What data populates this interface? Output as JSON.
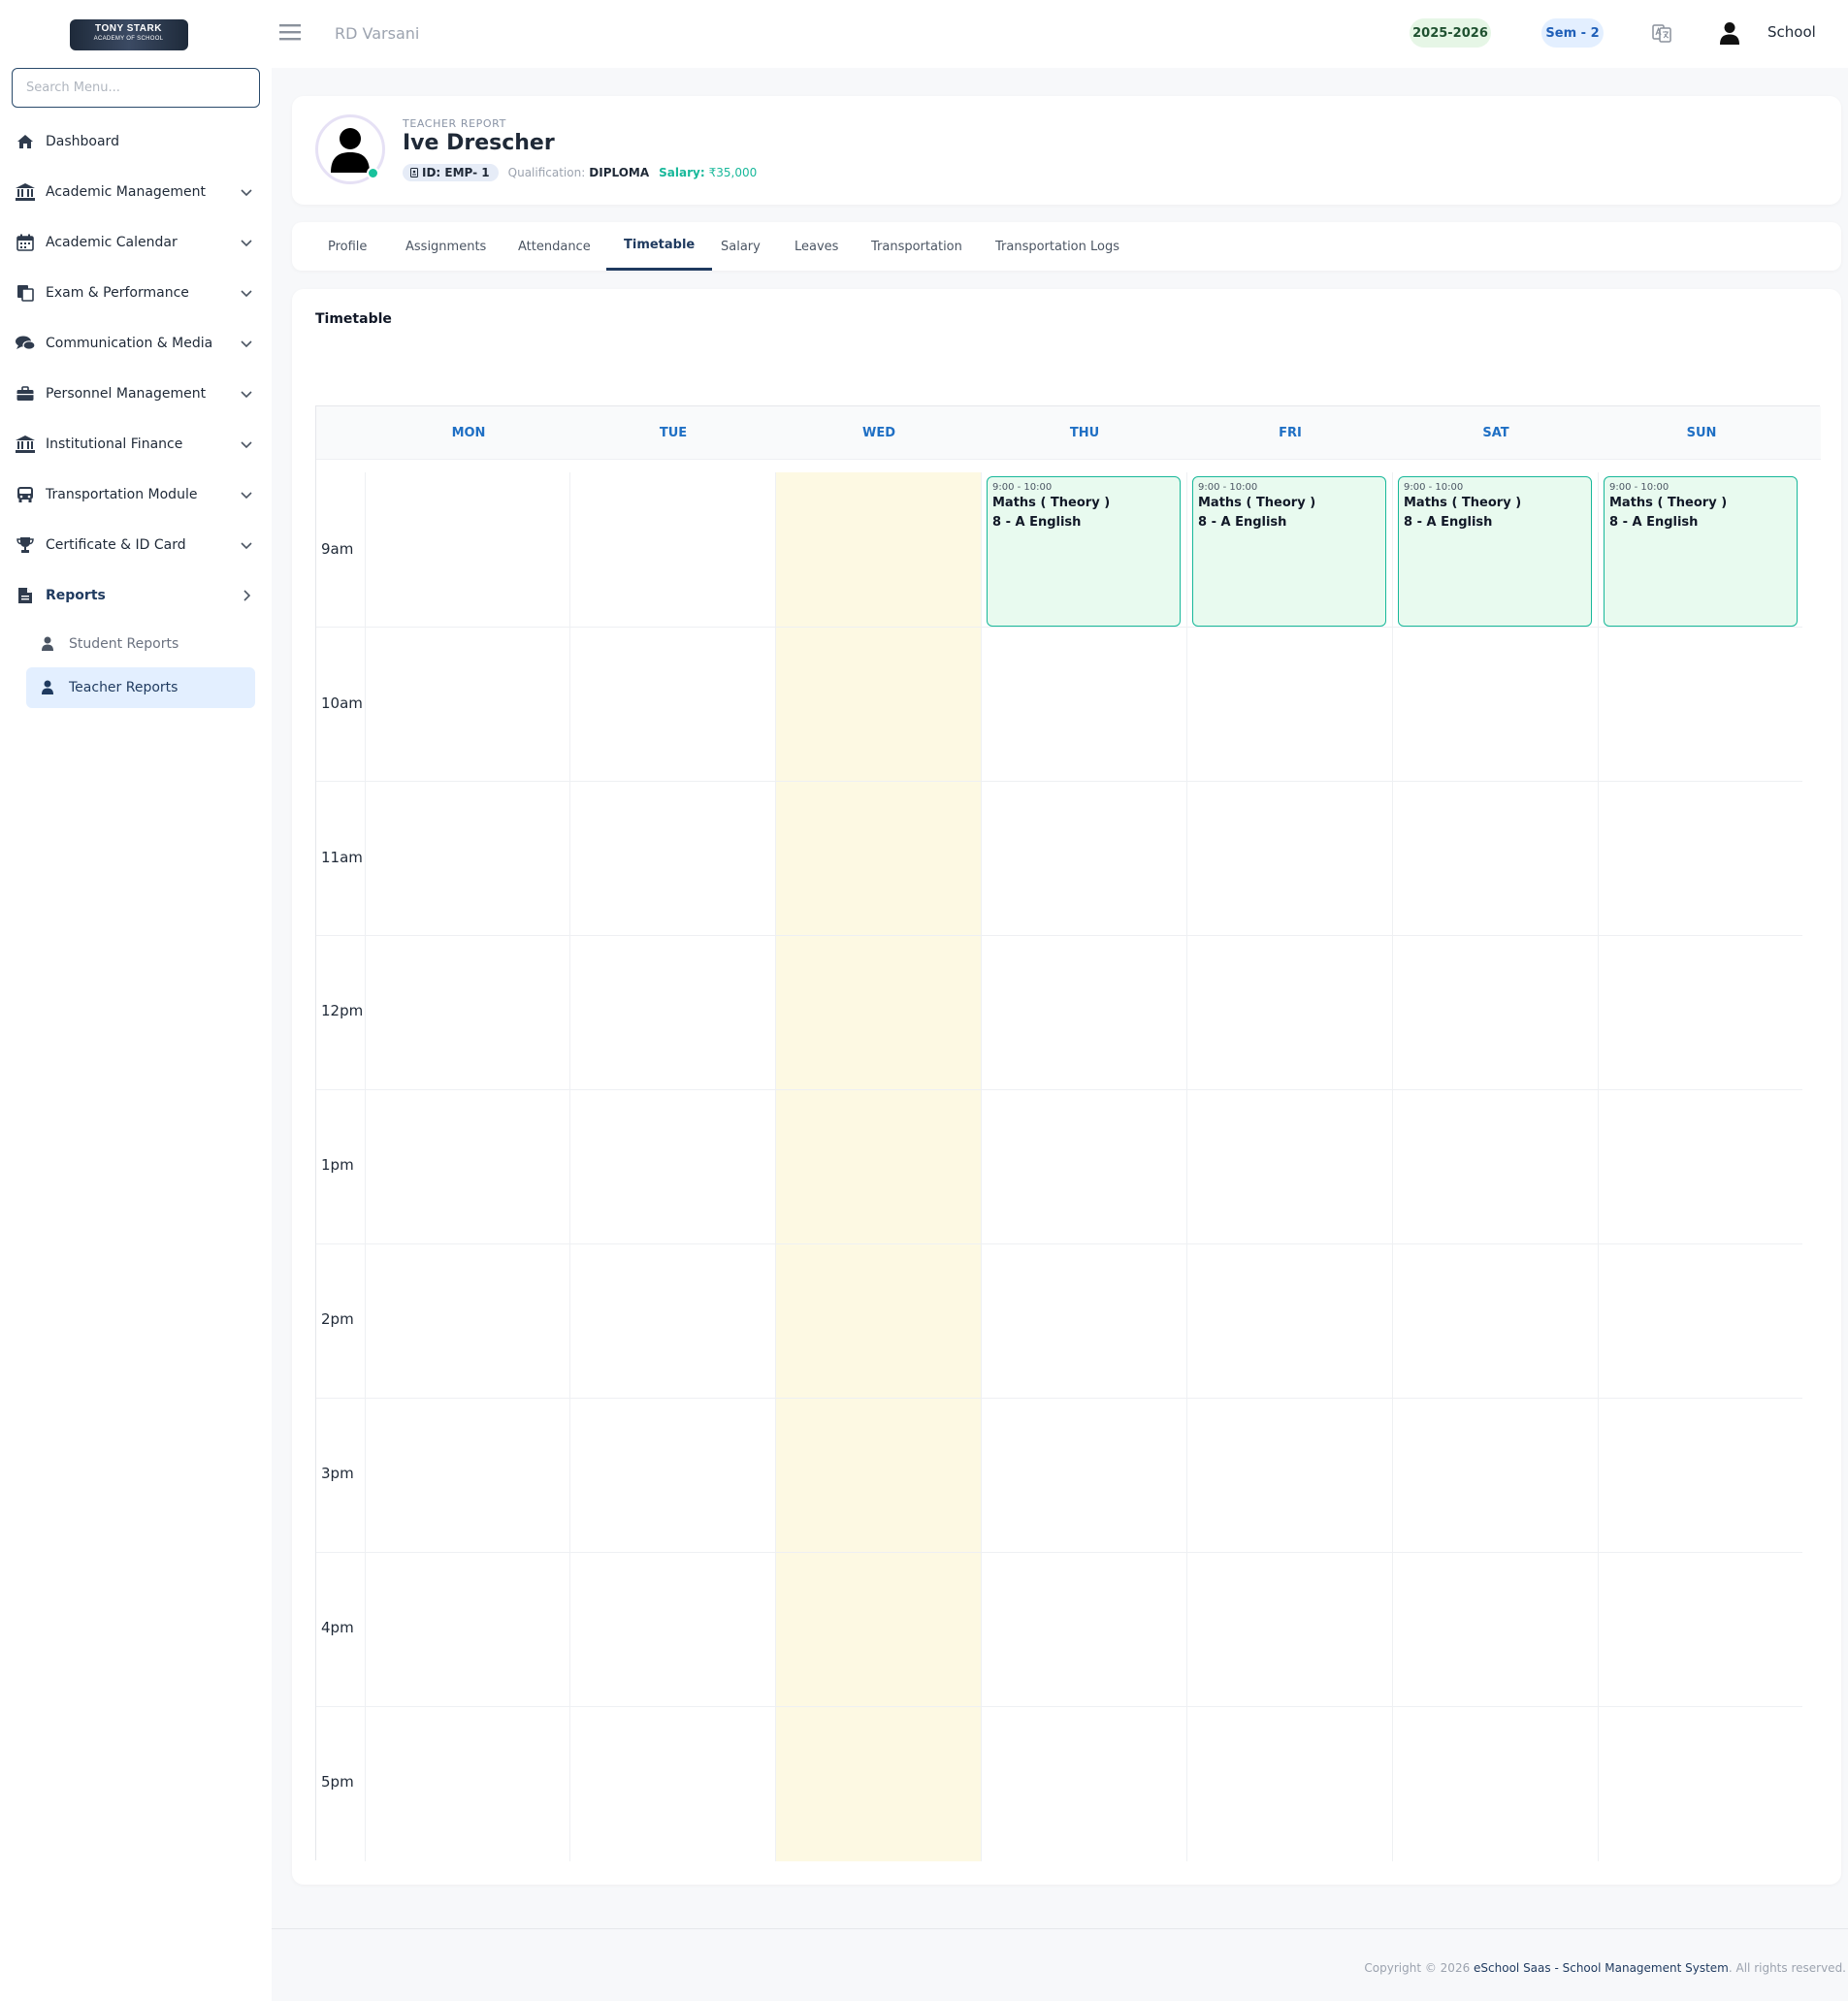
{
  "brand": {
    "logo_line1": "TONY STARK",
    "logo_line2": "ACADEMY OF SCHOOL"
  },
  "sidebar": {
    "search_placeholder": "Search Menu...",
    "items": [
      {
        "label": "Dashboard",
        "icon": "home-icon"
      },
      {
        "label": "Academic Management",
        "icon": "institution-icon"
      },
      {
        "label": "Academic Calendar",
        "icon": "calendar-icon"
      },
      {
        "label": "Exam & Performance",
        "icon": "copy-icon"
      },
      {
        "label": "Communication & Media",
        "icon": "comments-icon"
      },
      {
        "label": "Personnel Management",
        "icon": "briefcase-icon"
      },
      {
        "label": "Institutional Finance",
        "icon": "institution-icon"
      },
      {
        "label": "Transportation Module",
        "icon": "bus-icon"
      },
      {
        "label": "Certificate & ID Card",
        "icon": "trophy-icon"
      },
      {
        "label": "Reports",
        "icon": "file-icon"
      }
    ],
    "sub_items": [
      {
        "label": "Student Reports",
        "icon": "user-icon"
      },
      {
        "label": "Teacher Reports",
        "icon": "user-icon",
        "active": true
      }
    ]
  },
  "topbar": {
    "school_name": "RD Varsani",
    "session": "2025-2026",
    "semester": "Sem - 2",
    "user_label": "School"
  },
  "profile": {
    "kicker": "TEACHER REPORT",
    "name": "Ive Drescher",
    "id": "ID: EMP- 1",
    "qualification_label": "Qualification:",
    "qualification": "DIPLOMA",
    "salary_label": "Salary:",
    "salary": "₹35,000"
  },
  "tabs": [
    {
      "label": "Profile"
    },
    {
      "label": "Assignments"
    },
    {
      "label": "Attendance"
    },
    {
      "label": "Timetable",
      "active": true
    },
    {
      "label": "Salary"
    },
    {
      "label": "Leaves"
    },
    {
      "label": "Transportation"
    },
    {
      "label": "Transportation Logs"
    }
  ],
  "timetable": {
    "title": "Timetable",
    "days": [
      "MON",
      "TUE",
      "WED",
      "THU",
      "FRI",
      "SAT",
      "SUN"
    ],
    "highlight_day": "WED",
    "times": [
      "9am",
      "10am",
      "11am",
      "12pm",
      "1pm",
      "2pm",
      "3pm",
      "4pm",
      "5pm"
    ],
    "events": [
      {
        "day": "THU",
        "time": "9:00 - 10:00",
        "subject": "Maths ( Theory )",
        "class": "8 - A English"
      },
      {
        "day": "FRI",
        "time": "9:00 - 10:00",
        "subject": "Maths ( Theory )",
        "class": "8 - A English"
      },
      {
        "day": "SAT",
        "time": "9:00 - 10:00",
        "subject": "Maths ( Theory )",
        "class": "8 - A English"
      },
      {
        "day": "SUN",
        "time": "9:00 - 10:00",
        "subject": "Maths ( Theory )",
        "class": "8 - A English"
      }
    ]
  },
  "footer": {
    "prefix": "Copyright © 2026 ",
    "brand": "eSchool Saas - School Management System",
    "suffix": ". All rights reserved."
  }
}
